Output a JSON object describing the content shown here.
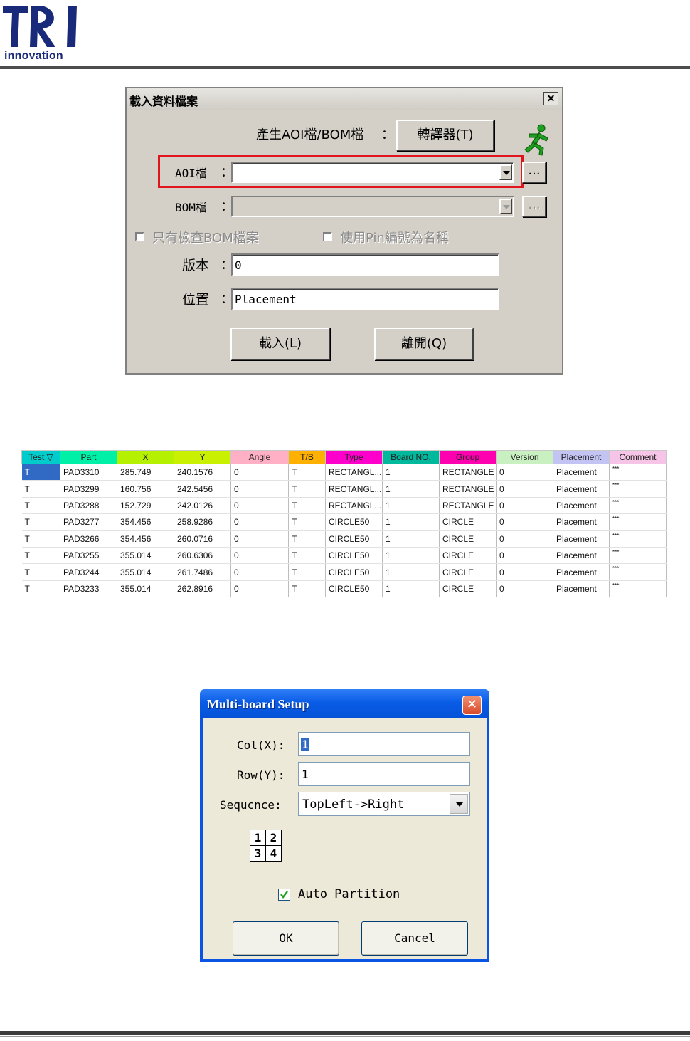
{
  "brand": {
    "logo_text": "TRI",
    "logo_subtext": "innovation"
  },
  "dialog1": {
    "title": "載入資料檔案",
    "close": "✕",
    "generate_label": "產生AOI檔/BOM檔",
    "colon": "：",
    "converter_button": "轉譯器(T)",
    "aoi_label": "AOI檔",
    "aoi_value": "",
    "bom_label": "BOM檔",
    "bom_value": "",
    "browse": "...",
    "check_bom_only": "只有檢查BOM檔案",
    "use_pin_number": "使用Pin編號為名稱",
    "version_label": "版本",
    "version_value": "0",
    "position_label": "位置",
    "position_value": "Placement",
    "load_button": "載入(L)",
    "leave_button": "離開(Q)"
  },
  "grid": {
    "columns": [
      {
        "label": "Test ▽",
        "color": "#00cccc"
      },
      {
        "label": "Part",
        "color": "#00f0a8"
      },
      {
        "label": "X",
        "color": "#b4f000"
      },
      {
        "label": "Y",
        "color": "#c8f000"
      },
      {
        "label": "Angle",
        "color": "#ffb0c4"
      },
      {
        "label": "T/B",
        "color": "#ffb000"
      },
      {
        "label": "Type",
        "color": "#ff00cc"
      },
      {
        "label": "Board NO.",
        "color": "#00b89c"
      },
      {
        "label": "Group",
        "color": "#ff00b0"
      },
      {
        "label": "Version",
        "color": "#c8f0c0"
      },
      {
        "label": "Placement",
        "color": "#c4c4f4"
      },
      {
        "label": "Comment",
        "color": "#f6c4e6"
      }
    ],
    "rows": [
      [
        "T",
        "PAD3310",
        "285.749",
        "240.1576",
        "0",
        "T",
        "RECTANGL...",
        "1",
        "RECTANGLE",
        "0",
        "Placement",
        "***"
      ],
      [
        "T",
        "PAD3299",
        "160.756",
        "242.5456",
        "0",
        "T",
        "RECTANGL...",
        "1",
        "RECTANGLE",
        "0",
        "Placement",
        "***"
      ],
      [
        "T",
        "PAD3288",
        "152.729",
        "242.0126",
        "0",
        "T",
        "RECTANGL...",
        "1",
        "RECTANGLE",
        "0",
        "Placement",
        "***"
      ],
      [
        "T",
        "PAD3277",
        "354.456",
        "258.9286",
        "0",
        "T",
        "CIRCLE50",
        "1",
        "CIRCLE",
        "0",
        "Placement",
        "***"
      ],
      [
        "T",
        "PAD3266",
        "354.456",
        "260.0716",
        "0",
        "T",
        "CIRCLE50",
        "1",
        "CIRCLE",
        "0",
        "Placement",
        "***"
      ],
      [
        "T",
        "PAD3255",
        "355.014",
        "260.6306",
        "0",
        "T",
        "CIRCLE50",
        "1",
        "CIRCLE",
        "0",
        "Placement",
        "***"
      ],
      [
        "T",
        "PAD3244",
        "355.014",
        "261.7486",
        "0",
        "T",
        "CIRCLE50",
        "1",
        "CIRCLE",
        "0",
        "Placement",
        "***"
      ],
      [
        "T",
        "PAD3233",
        "355.014",
        "262.8916",
        "0",
        "T",
        "CIRCLE50",
        "1",
        "CIRCLE",
        "0",
        "Placement",
        "***"
      ]
    ]
  },
  "dialog2": {
    "title": "Multi-board Setup",
    "close": "✕",
    "col_label": "Col(X):",
    "col_value": "1",
    "row_label": "Row(Y):",
    "row_value": "1",
    "sequence_label": "Sequcnce:",
    "sequence_value": "TopLeft->Right",
    "quad": [
      "1",
      "2",
      "3",
      "4"
    ],
    "auto_partition_label": "Auto Partition",
    "auto_partition_checked": true,
    "ok": "OK",
    "cancel": "Cancel"
  }
}
